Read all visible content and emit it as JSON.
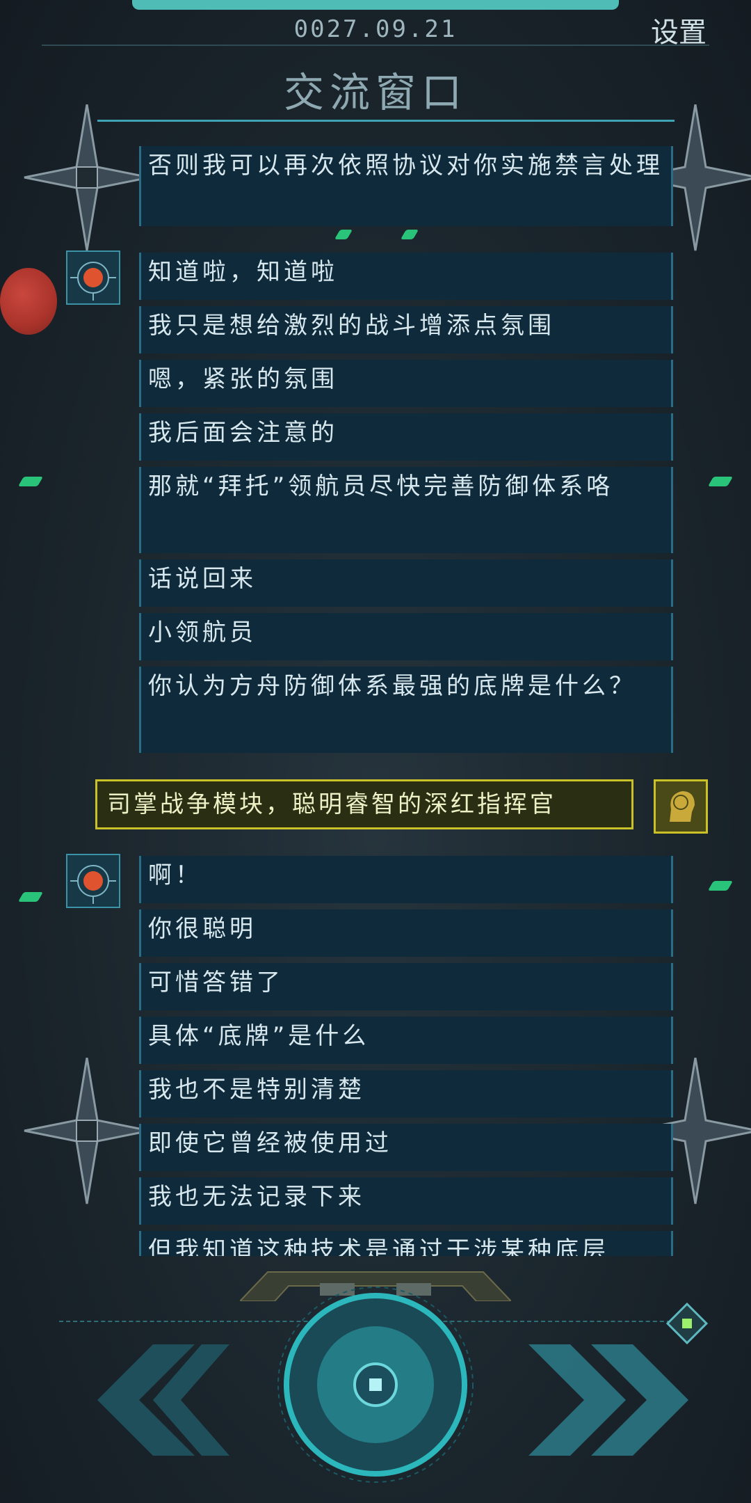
{
  "header": {
    "date": "0027.09.21",
    "settings_label": "设置",
    "title": "交流窗口"
  },
  "messages_npc_1": [
    "否则我可以再次依照协议对你实施禁言处理"
  ],
  "messages_npc_2": [
    "知道啦，知道啦",
    "我只是想给激烈的战斗增添点氛围",
    "嗯，紧张的氛围",
    "我后面会注意的",
    "那就“拜托”领航员尽快完善防御体系咯",
    "话说回来",
    "小领航员",
    "你认为方舟防御体系最强的底牌是什么？"
  ],
  "player_reply": "司掌战争模块，聪明睿智的深红指挥官",
  "messages_npc_3": [
    "啊！",
    "你很聪明",
    "可惜答错了",
    "具体“底牌”是什么",
    "我也不是特别清楚",
    "即使它曾经被使用过",
    "我也无法记录下来",
    "但我知道这种技术是通过干涉某种底层"
  ],
  "icons": {
    "npc_avatar": "circuit-orb-icon",
    "player_avatar": "brain-head-icon",
    "rewind": "double-chevron-left-icon",
    "forward": "double-chevron-right-icon",
    "main": "record-circle-icon",
    "skip": "diamond-gem-icon"
  },
  "colors": {
    "accent": "#59d8cf",
    "bubble": "#0f2a3a",
    "player_border": "#c9c127",
    "planet": "#c9473d",
    "gem": "#29c37a"
  }
}
